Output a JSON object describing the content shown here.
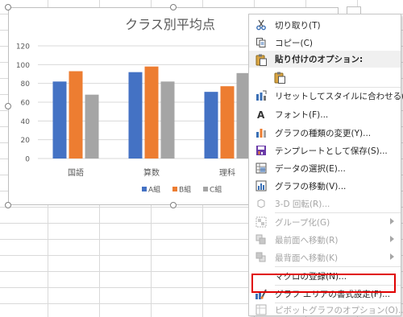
{
  "chart_data": {
    "type": "bar",
    "title": "クラス別平均点",
    "categories": [
      "国語",
      "算数",
      "理科"
    ],
    "series": [
      {
        "name": "A組",
        "color": "#4472c4",
        "values": [
          82,
          92,
          71
        ]
      },
      {
        "name": "B組",
        "color": "#ed7d31",
        "values": [
          93,
          98,
          77
        ]
      },
      {
        "name": "C組",
        "color": "#a5a5a5",
        "values": [
          68,
          82,
          91
        ]
      }
    ],
    "ylim": [
      0,
      120
    ],
    "yticks": [
      0,
      20,
      40,
      60,
      80,
      100,
      120
    ],
    "grid": true,
    "legend": "bottom"
  },
  "menu": {
    "items": [
      {
        "label": "切り取り(T)",
        "icon": "scissors-icon",
        "enabled": true
      },
      {
        "label": "コピー(C)",
        "icon": "copy-icon",
        "enabled": true
      },
      {
        "label": "貼り付けのオプション:",
        "icon": "paste-options-icon",
        "enabled": true,
        "header": true
      },
      {
        "label": "",
        "icon": "paste-icon",
        "enabled": true
      },
      {
        "label": "リセットしてスタイルに合わせる(A)",
        "icon": "reset-style-icon",
        "enabled": true
      },
      {
        "label": "フォント(F)...",
        "icon": "font-icon",
        "enabled": true
      },
      {
        "label": "グラフの種類の変更(Y)...",
        "icon": "chart-type-icon",
        "enabled": true
      },
      {
        "label": "テンプレートとして保存(S)...",
        "icon": "save-template-icon",
        "enabled": true
      },
      {
        "label": "データの選択(E)...",
        "icon": "select-data-icon",
        "enabled": true
      },
      {
        "label": "グラフの移動(V)...",
        "icon": "move-chart-icon",
        "enabled": true
      },
      {
        "label": "3-D 回転(R)...",
        "icon": "rotate-3d-icon",
        "enabled": false
      },
      {
        "label": "グループ化(G)",
        "icon": "group-icon",
        "enabled": false,
        "submenu": true
      },
      {
        "label": "最前面へ移動(R)",
        "icon": "bring-front-icon",
        "enabled": false,
        "submenu": true
      },
      {
        "label": "最背面へ移動(K)",
        "icon": "send-back-icon",
        "enabled": false,
        "submenu": true
      },
      {
        "label": "マクロの登録(N)...",
        "icon": "",
        "enabled": true
      },
      {
        "label": "グラフ エリアの書式設定(F)...",
        "icon": "format-chart-area-icon",
        "enabled": true,
        "highlighted": true
      },
      {
        "label": "ピボットグラフのオプション(O)...",
        "icon": "pivot-options-icon",
        "enabled": false
      }
    ]
  }
}
